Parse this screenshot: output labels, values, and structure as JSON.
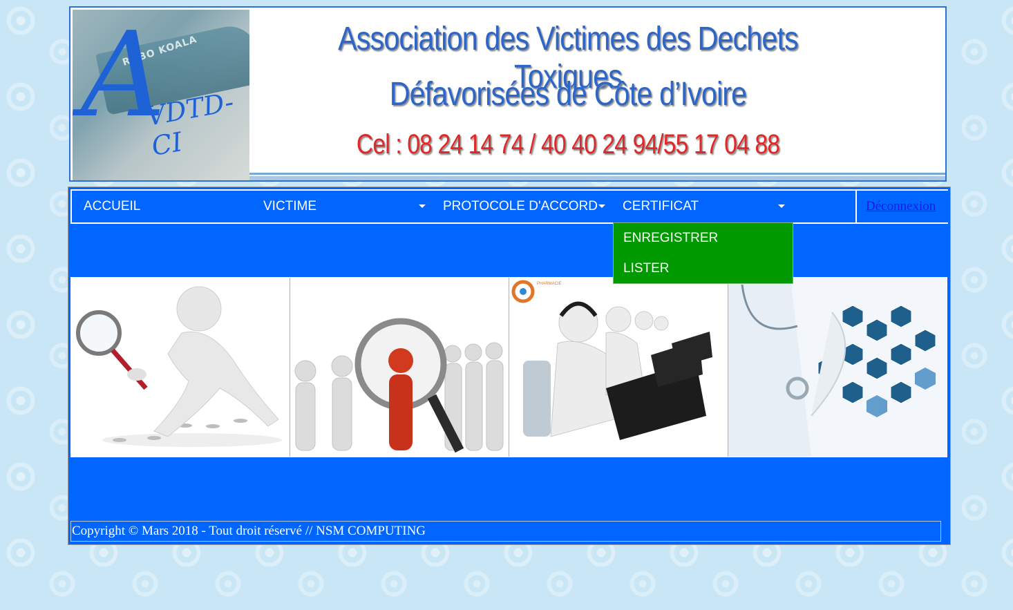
{
  "banner": {
    "ship_name": "ROBO KOALA",
    "logo_letter": "A",
    "logo_rest": "VDTD-CI",
    "title_line1": "Association des Victimes des Dechets Toxiques",
    "title_line2": "Défavorisées de Côte d’Ivoire",
    "phone": "Cel : 08 24 14 74 / 40 40  24 94/55 17 04 88"
  },
  "nav": {
    "items": [
      {
        "label": "ACCUEIL",
        "has_dropdown": false
      },
      {
        "label": "VICTIME",
        "has_dropdown": true
      },
      {
        "label": "PROTOCOLE D'ACCORD",
        "has_dropdown": true
      },
      {
        "label": "CERTIFICAT",
        "has_dropdown": true,
        "open": true
      }
    ],
    "logout": "Déconnexion"
  },
  "dropdown": {
    "parent": "CERTIFICAT",
    "items": [
      "ENREGISTRER",
      "LISTER"
    ]
  },
  "gallery": {
    "images": [
      "magnifier-man-image",
      "people-search-image",
      "call-center-image",
      "medical-icons-image"
    ]
  },
  "footer": {
    "text": "Copyright © Mars 2018 - Tout droit réservé // NSM COMPUTING"
  },
  "colors": {
    "nav_bg": "#0066ff",
    "dropdown_bg": "#009900",
    "banner_blue": "#2c66c8",
    "phone_red": "#e02828",
    "page_bg": "#c9e6f6"
  }
}
